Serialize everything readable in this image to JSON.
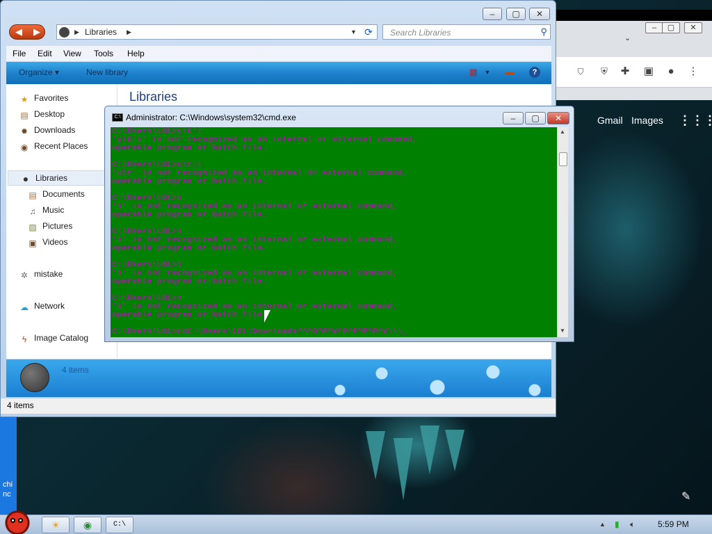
{
  "explorer": {
    "address": {
      "path": "Libraries"
    },
    "search": {
      "placeholder": "Search Libraries"
    },
    "menu": [
      "File",
      "Edit",
      "View",
      "Tools",
      "Help"
    ],
    "commands": {
      "organize": "Organize ▾",
      "new_library": "New library"
    },
    "heading": "Libraries",
    "nav": {
      "favorites": "Favorites",
      "desktop": "Desktop",
      "downloads": "Downloads",
      "recent": "Recent Places",
      "libraries": "Libraries",
      "documents": "Documents",
      "music": "Music",
      "pictures": "Pictures",
      "videos": "Videos",
      "mistake": "mistake",
      "network": "Network",
      "image_catalog": "Image Catalog"
    },
    "details_text": "4 items",
    "status_text": "4 items"
  },
  "cmd": {
    "title": "Administrator: C:\\Windows\\system32\\cmd.exe",
    "lines": [
      "C:\\Users\\LOL>yi6'i",
      "'yi6'i' is not recognized as an internal or external command,",
      "operable program or batch file.",
      "",
      "C:\\Users\\LOL>u1r;i",
      "'u1r' is not recognized as an internal or external command,",
      "operable program or batch file.",
      "",
      "C:\\Users\\LOL>i",
      "'i' is not recognized as an internal or external command,",
      "operable program or batch file.",
      "",
      "C:\\Users\\LOL>i",
      "'i' is not recognized as an internal or external command,",
      "operable program or batch file.",
      "",
      "C:\\Users\\LOL>i",
      "'i' is not recognized as an internal or external command,",
      "operable program or batch file.",
      "",
      "C:\\Users\\LOL>i",
      "'i' is not recognized as an internal or external command,",
      "operable program or batch file.",
      "",
      "C:\\Users\\LOL>cdC:\\Users\\LOL\\Downloads^^^O^P^V^P^P^P^P^V\\\\\\_"
    ]
  },
  "browser": {
    "gmail": "Gmail",
    "images": "Images"
  },
  "desktop": {
    "left_text_1": "chi",
    "left_text_2": "nc"
  },
  "taskbar": {
    "clock": "5:59 PM"
  },
  "colors": {
    "cmd_bg": "#008000",
    "cmd_fg": "#8c2b8c",
    "title_blue": "#1e3f8a"
  }
}
